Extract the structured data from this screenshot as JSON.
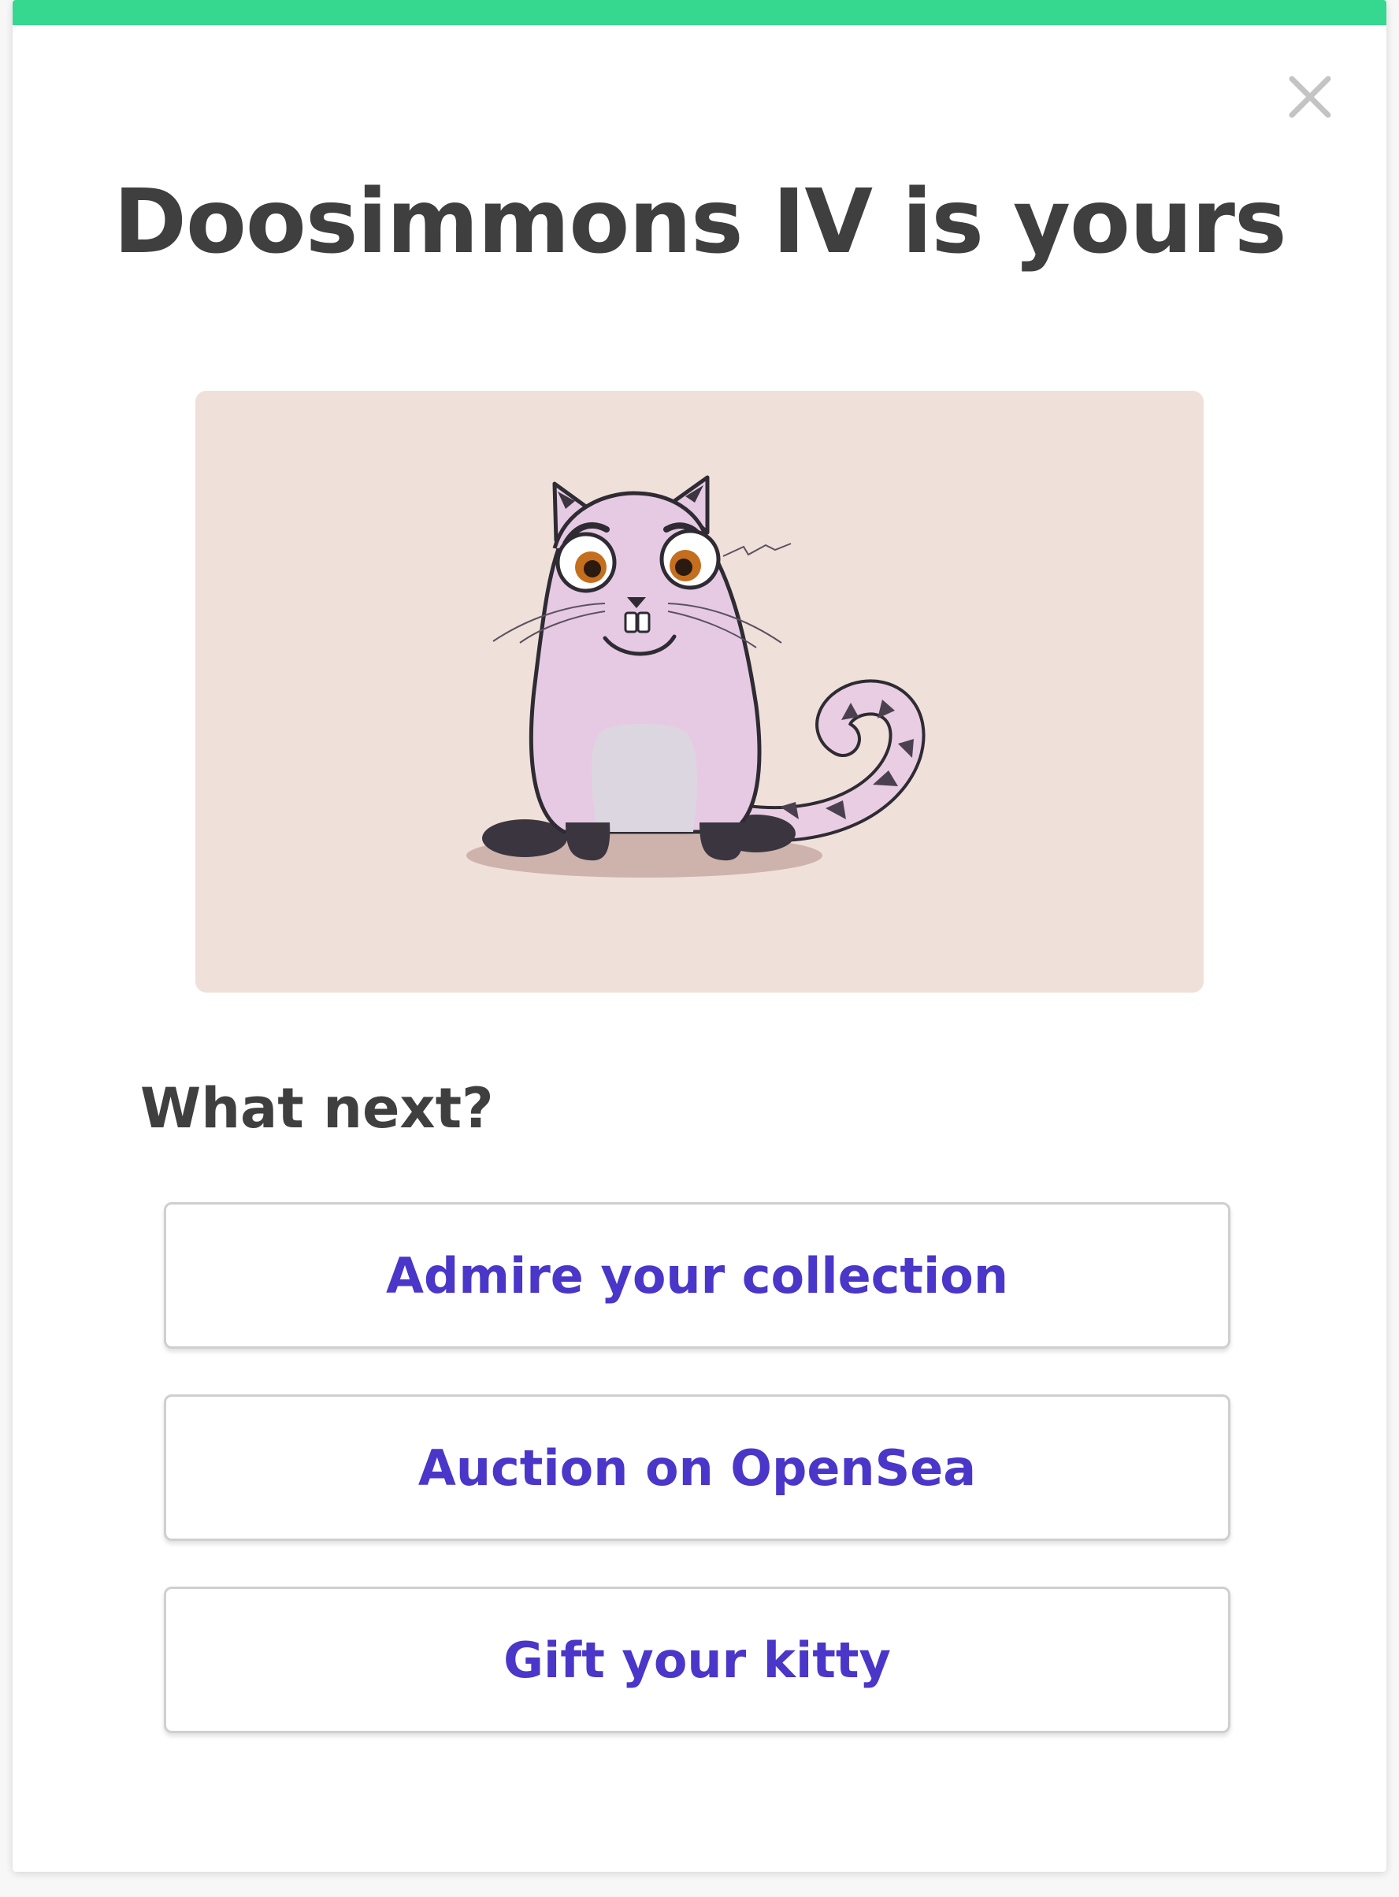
{
  "modal": {
    "title": "Doosimmons IV is yours",
    "close_icon": "close-icon",
    "accent_color": "#35d88e",
    "card_background": "#f0e0da",
    "kitty_image": "pink-cartoon-cat-with-spotted-tail"
  },
  "next": {
    "heading": "What next?",
    "link_color": "#4a36c8",
    "actions": [
      {
        "label": "Admire your collection"
      },
      {
        "label": "Auction on OpenSea"
      },
      {
        "label": "Gift your kitty"
      }
    ]
  }
}
